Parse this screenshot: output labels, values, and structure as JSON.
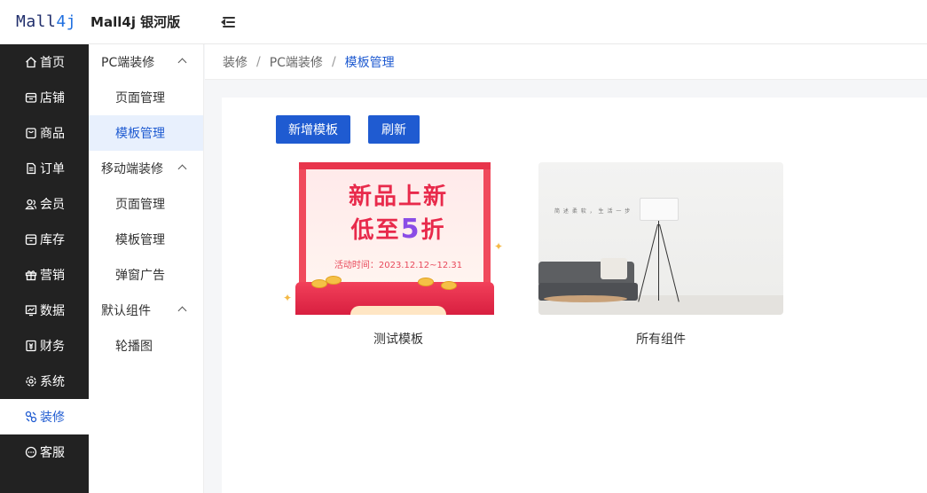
{
  "header": {
    "logo_prefix": "Mall",
    "logo_accent": "4j",
    "app_title": "Mall4j 银河版"
  },
  "sidebar": {
    "items": [
      {
        "label": "首页",
        "icon": "home-icon"
      },
      {
        "label": "店铺",
        "icon": "store-icon"
      },
      {
        "label": "商品",
        "icon": "product-icon"
      },
      {
        "label": "订单",
        "icon": "order-icon"
      },
      {
        "label": "会员",
        "icon": "member-icon"
      },
      {
        "label": "库存",
        "icon": "inventory-icon"
      },
      {
        "label": "营销",
        "icon": "gift-icon"
      },
      {
        "label": "数据",
        "icon": "chart-icon"
      },
      {
        "label": "财务",
        "icon": "finance-icon"
      },
      {
        "label": "系统",
        "icon": "gear-icon"
      },
      {
        "label": "装修",
        "icon": "decorate-icon"
      },
      {
        "label": "客服",
        "icon": "chat-icon"
      }
    ],
    "active_index": 10,
    "active_color": "#1f5bd1"
  },
  "submenu": {
    "groups": [
      {
        "label": "PC端装修",
        "items": [
          "页面管理",
          "模板管理"
        ]
      },
      {
        "label": "移动端装修",
        "items": [
          "页面管理",
          "模板管理",
          "弹窗广告"
        ]
      },
      {
        "label": "默认组件",
        "items": [
          "轮播图"
        ]
      }
    ]
  },
  "breadcrumb": {
    "items": [
      "装修",
      "PC端装修"
    ],
    "current": "模板管理",
    "separator": "/"
  },
  "toolbar": {
    "add_label": "新增模板",
    "refresh_label": "刷新",
    "button_color": "#1f5bd1"
  },
  "templates": [
    {
      "name": "测试模板",
      "thumb": {
        "line1": "新品上新",
        "line2_prefix": "低至",
        "line2_number": "5",
        "line2_suffix": "折",
        "date": "活动时间：2023.12.12~12.31"
      }
    },
    {
      "name": "所有组件",
      "thumb": {
        "tagline": "简 述 柔 软 ， 生 活 一 步"
      }
    }
  ]
}
